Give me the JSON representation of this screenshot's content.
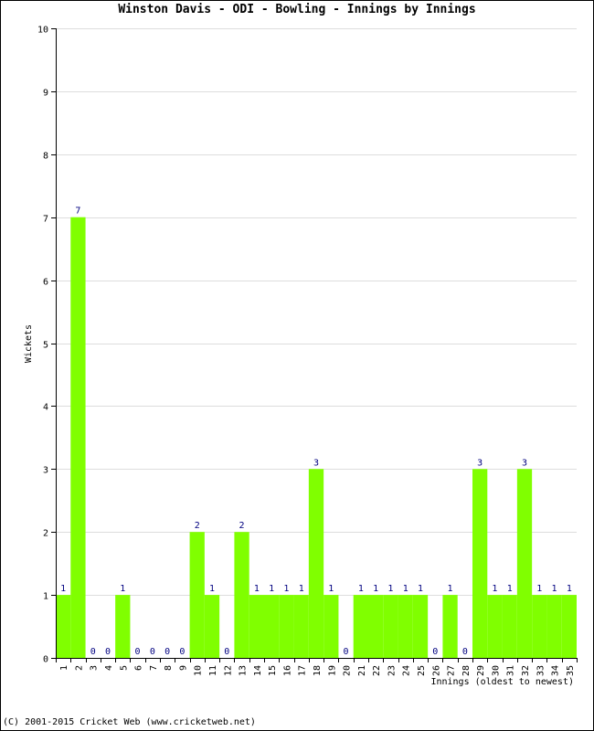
{
  "chart_data": {
    "type": "bar",
    "title": "Winston Davis - ODI - Bowling - Innings by Innings",
    "xlabel": "Innings (oldest to newest)",
    "ylabel": "Wickets",
    "ylim": [
      0,
      10
    ],
    "yticks": [
      0,
      1,
      2,
      3,
      4,
      5,
      6,
      7,
      8,
      9,
      10
    ],
    "grid": true,
    "categories": [
      "1",
      "2",
      "3",
      "4",
      "5",
      "6",
      "7",
      "8",
      "9",
      "10",
      "11",
      "12",
      "13",
      "14",
      "15",
      "16",
      "17",
      "18",
      "19",
      "20",
      "21",
      "22",
      "23",
      "24",
      "25",
      "26",
      "27",
      "28",
      "29",
      "30",
      "31",
      "32",
      "33",
      "34",
      "35"
    ],
    "values": [
      1,
      7,
      0,
      0,
      1,
      0,
      0,
      0,
      0,
      2,
      1,
      0,
      2,
      1,
      1,
      1,
      1,
      3,
      1,
      0,
      1,
      1,
      1,
      1,
      1,
      0,
      1,
      0,
      3,
      1,
      1,
      3,
      1,
      1,
      1
    ],
    "colors": {
      "bar": "#80ff00",
      "label": "#000080",
      "grid": "#dddddd",
      "axis": "#000000"
    }
  },
  "footer": "(C) 2001-2015 Cricket Web (www.cricketweb.net)"
}
